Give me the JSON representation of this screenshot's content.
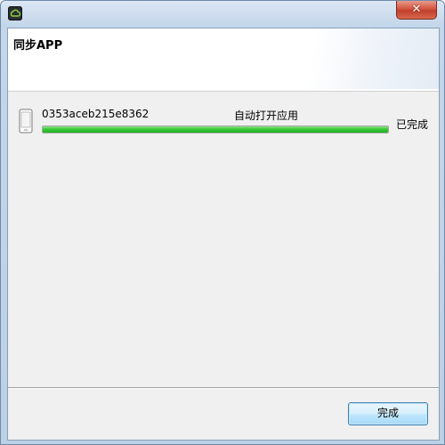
{
  "window": {
    "title": "同步APP",
    "close_glyph": "✕"
  },
  "device": {
    "id": "0353aceb215e8362",
    "status": "自动打开应用",
    "progress": 1.0,
    "result": "已完成"
  },
  "footer": {
    "finish_label": "完成"
  },
  "colors": {
    "progress": "#2bbf2a",
    "close": "#c94733"
  },
  "icons": {
    "app": "cloud-app-icon",
    "device": "phone-icon"
  }
}
